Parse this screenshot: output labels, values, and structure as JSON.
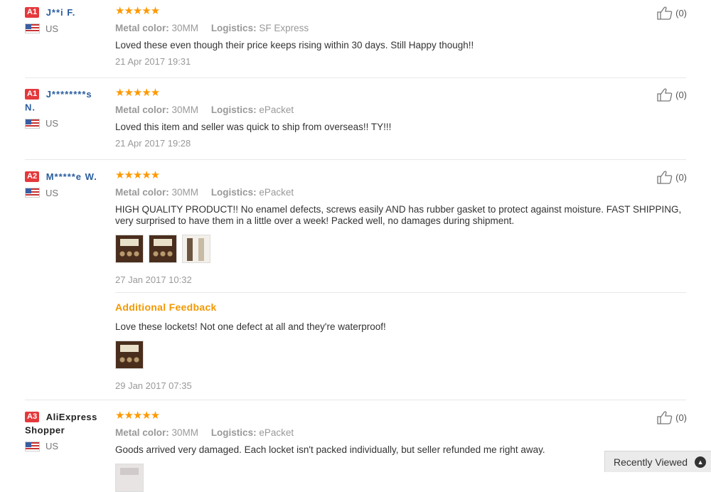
{
  "reviews": [
    {
      "badge": "A1",
      "user": "J**i F.",
      "country": "US",
      "stars": "★★★★★",
      "color_label": "Metal color:",
      "color_value": "30MM",
      "logistics_label": "Logistics:",
      "logistics_value": "SF Express",
      "text": "Loved these even though their price keeps rising within 30 days. Still Happy though!!",
      "date": "21 Apr 2017 19:31",
      "likes": "(0)"
    },
    {
      "badge": "A1",
      "user": "J********s",
      "user_line2": "N.",
      "country": "US",
      "stars": "★★★★★",
      "color_label": "Metal color:",
      "color_value": "30MM",
      "logistics_label": "Logistics:",
      "logistics_value": "ePacket",
      "text": "Loved this item and seller was quick to ship from overseas!! TY!!!",
      "date": "21 Apr 2017 19:28",
      "likes": "(0)"
    },
    {
      "badge": "A2",
      "user": "M*****e W.",
      "country": "US",
      "stars": "★★★★★",
      "color_label": "Metal color:",
      "color_value": "30MM",
      "logistics_label": "Logistics:",
      "logistics_value": "ePacket",
      "text": "HIGH QUALITY PRODUCT!! No enamel defects, screws easily AND has rubber gasket to protect against moisture. FAST SHIPPING, very surprised to have them in a little over a week! Packed well, no damages during shipment.",
      "date": "27 Jan 2017 10:32",
      "likes": "(0)",
      "additional_title": "Additional Feedback",
      "additional_text": "Love these lockets! Not one defect at all and they're waterproof!",
      "additional_date": "29 Jan 2017 07:35"
    },
    {
      "badge": "A3",
      "user": "AliExpress",
      "user_line2": "Shopper",
      "country": "US",
      "stars": "★★★★★",
      "color_label": "Metal color:",
      "color_value": "30MM",
      "logistics_label": "Logistics:",
      "logistics_value": "ePacket",
      "text": "Goods arrived very damaged. Each locket isn't packed individually, but seller refunded me right away.",
      "likes": "(0)"
    }
  ],
  "recently_viewed": "Recently Viewed",
  "colors": {
    "accent": "#ff9900",
    "badge": "#e4393c",
    "link": "#2a5d9f"
  }
}
